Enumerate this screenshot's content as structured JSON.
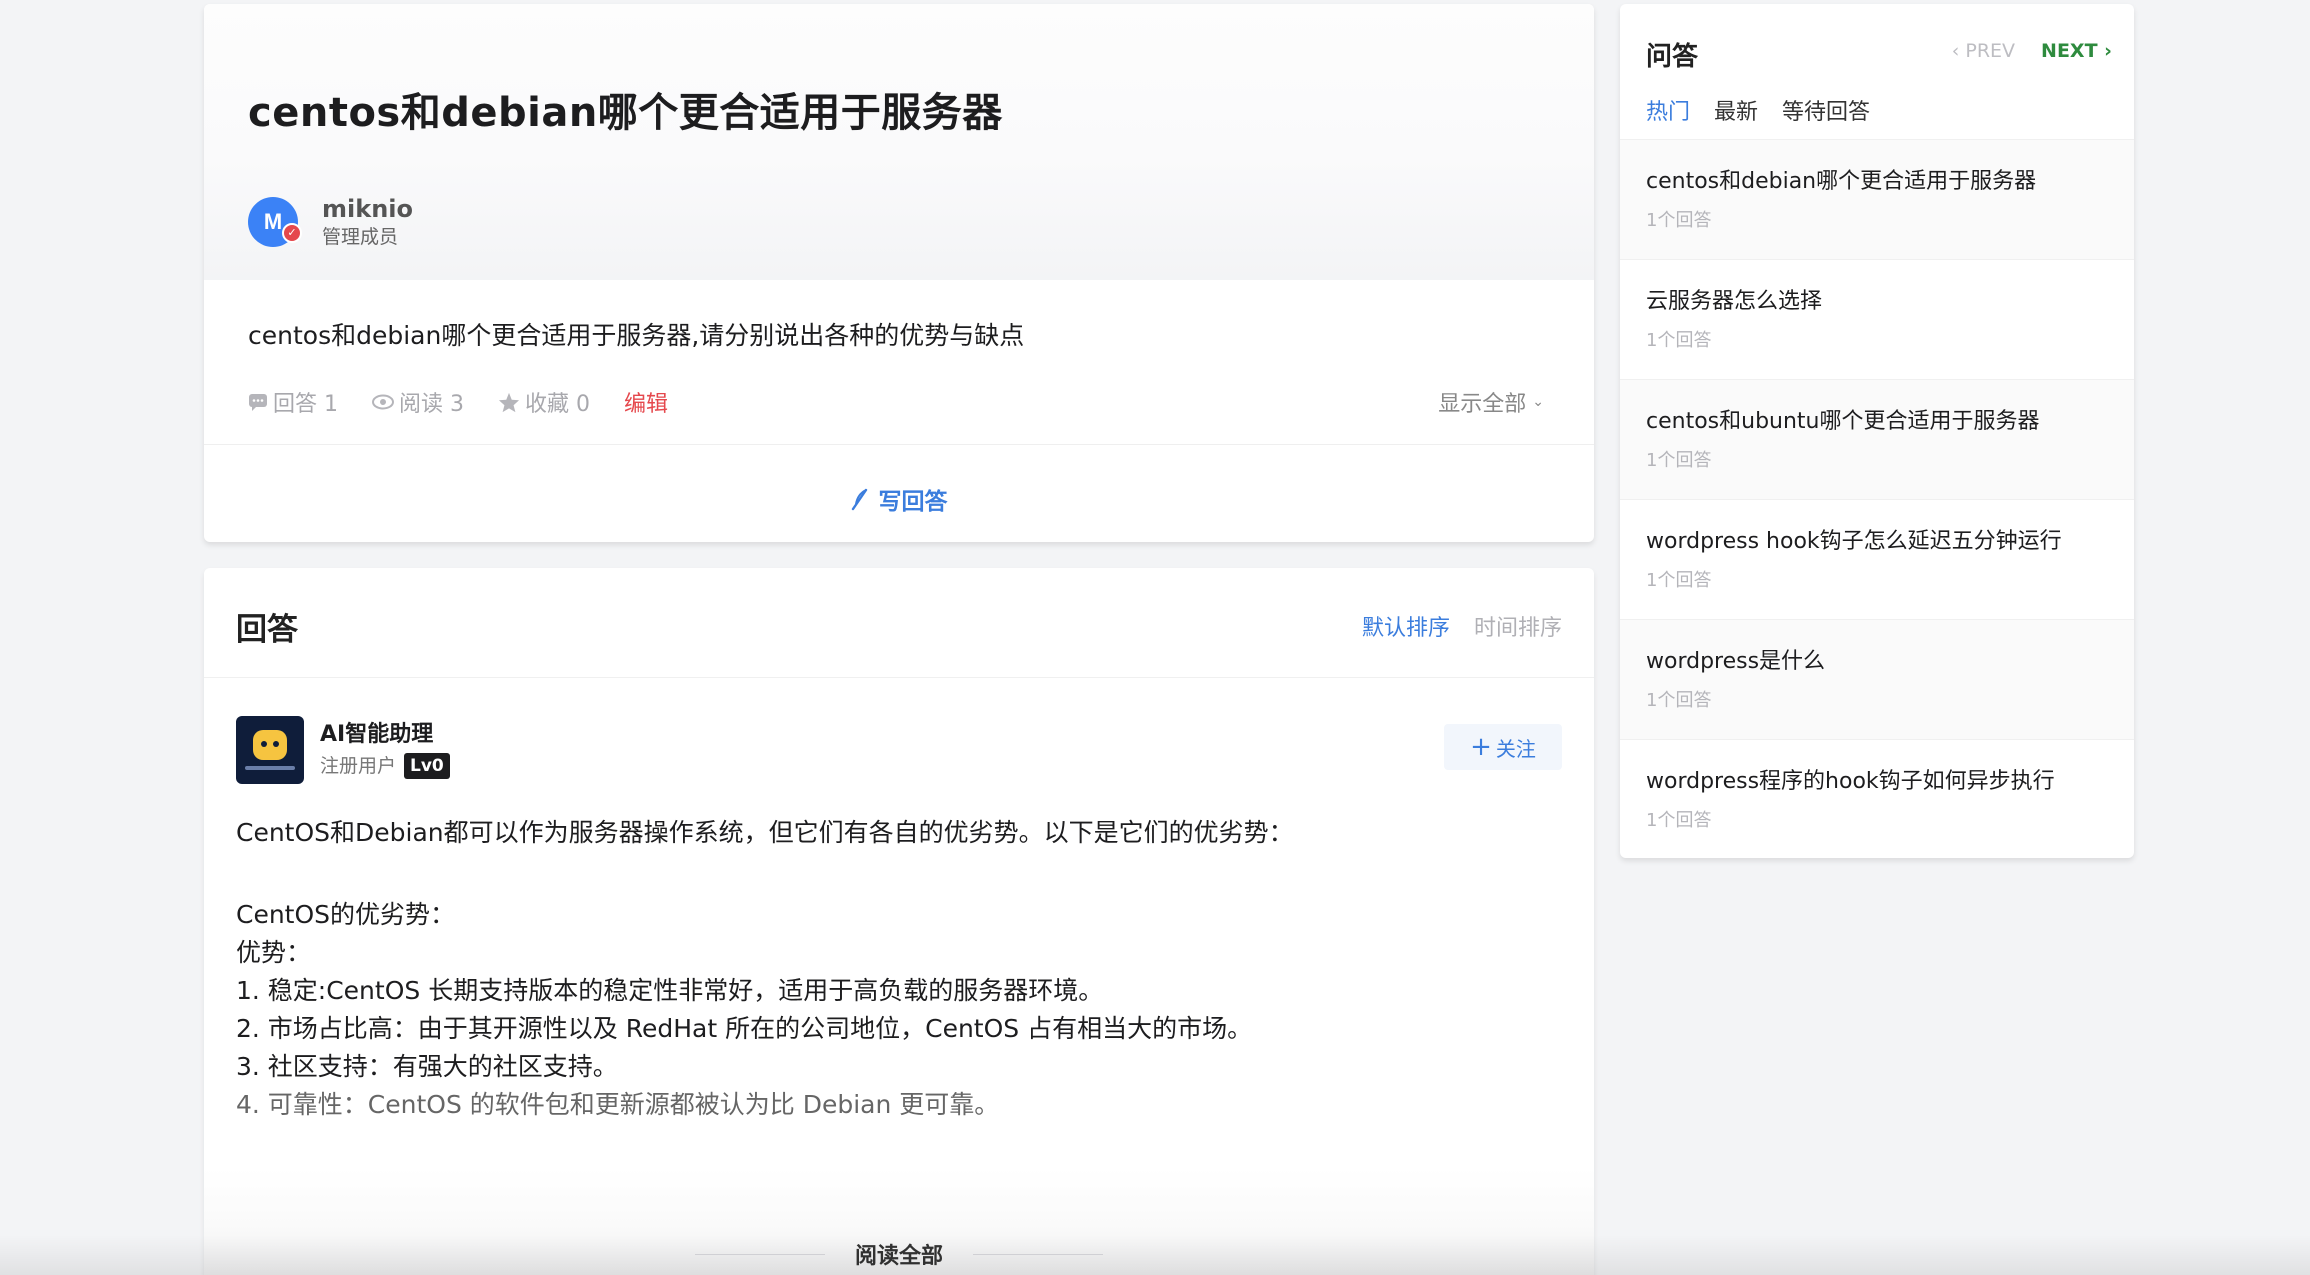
{
  "question": {
    "title": "centos和debian哪个更合适用于服务器",
    "author_name": "miknio",
    "author_role": "管理成员",
    "avatar_text": "M",
    "description": "centos和debian哪个更合适用于服务器,请分别说出各种的优势与缺点",
    "stats": {
      "answers": "回答 1",
      "reads": "阅读 3",
      "favorites": "收藏 0",
      "edit": "编辑"
    },
    "show_all": "显示全部",
    "write_answer": "写回答"
  },
  "answers": {
    "title": "回答",
    "sort_default": "默认排序",
    "sort_time": "时间排序",
    "author_name": "AI智能助理",
    "author_role": "注册用户",
    "level": "Lv0",
    "follow": "关注",
    "body": {
      "intro": "CentOS和Debian都可以作为服务器操作系统，但它们有各自的优劣势。以下是它们的优劣势：",
      "heading": "CentOS的优劣势：",
      "sub": "优势：",
      "point1": "1. 稳定:CentOS 长期支持版本的稳定性非常好，适用于高负载的服务器环境。",
      "point2": "2. 市场占比高：由于其开源性以及 RedHat 所在的公司地位，CentOS 占有相当大的市场。",
      "point3": "3. 社区支持：有强大的社区支持。",
      "point4": "4. 可靠性：CentOS 的软件包和更新源都被认为比 Debian 更可靠。"
    },
    "read_all": "阅读全部"
  },
  "sidebar": {
    "title": "问答",
    "prev": "PREV",
    "next": "NEXT",
    "tabs": [
      "热门",
      "最新",
      "等待回答"
    ],
    "items": [
      {
        "title": "centos和debian哪个更合适用于服务器",
        "count": "1个回答"
      },
      {
        "title": "云服务器怎么选择",
        "count": "1个回答"
      },
      {
        "title": "centos和ubuntu哪个更合适用于服务器",
        "count": "1个回答"
      },
      {
        "title": "wordpress hook钩子怎么延迟五分钟运行",
        "count": "1个回答"
      },
      {
        "title": "wordpress是什么",
        "count": "1个回答"
      },
      {
        "title": "wordpress程序的hook钩子如何异步执行",
        "count": "1个回答"
      }
    ]
  },
  "colors": {
    "accent": "#3b7ddd",
    "edit": "#e5484d",
    "next": "#2e8b3e"
  }
}
